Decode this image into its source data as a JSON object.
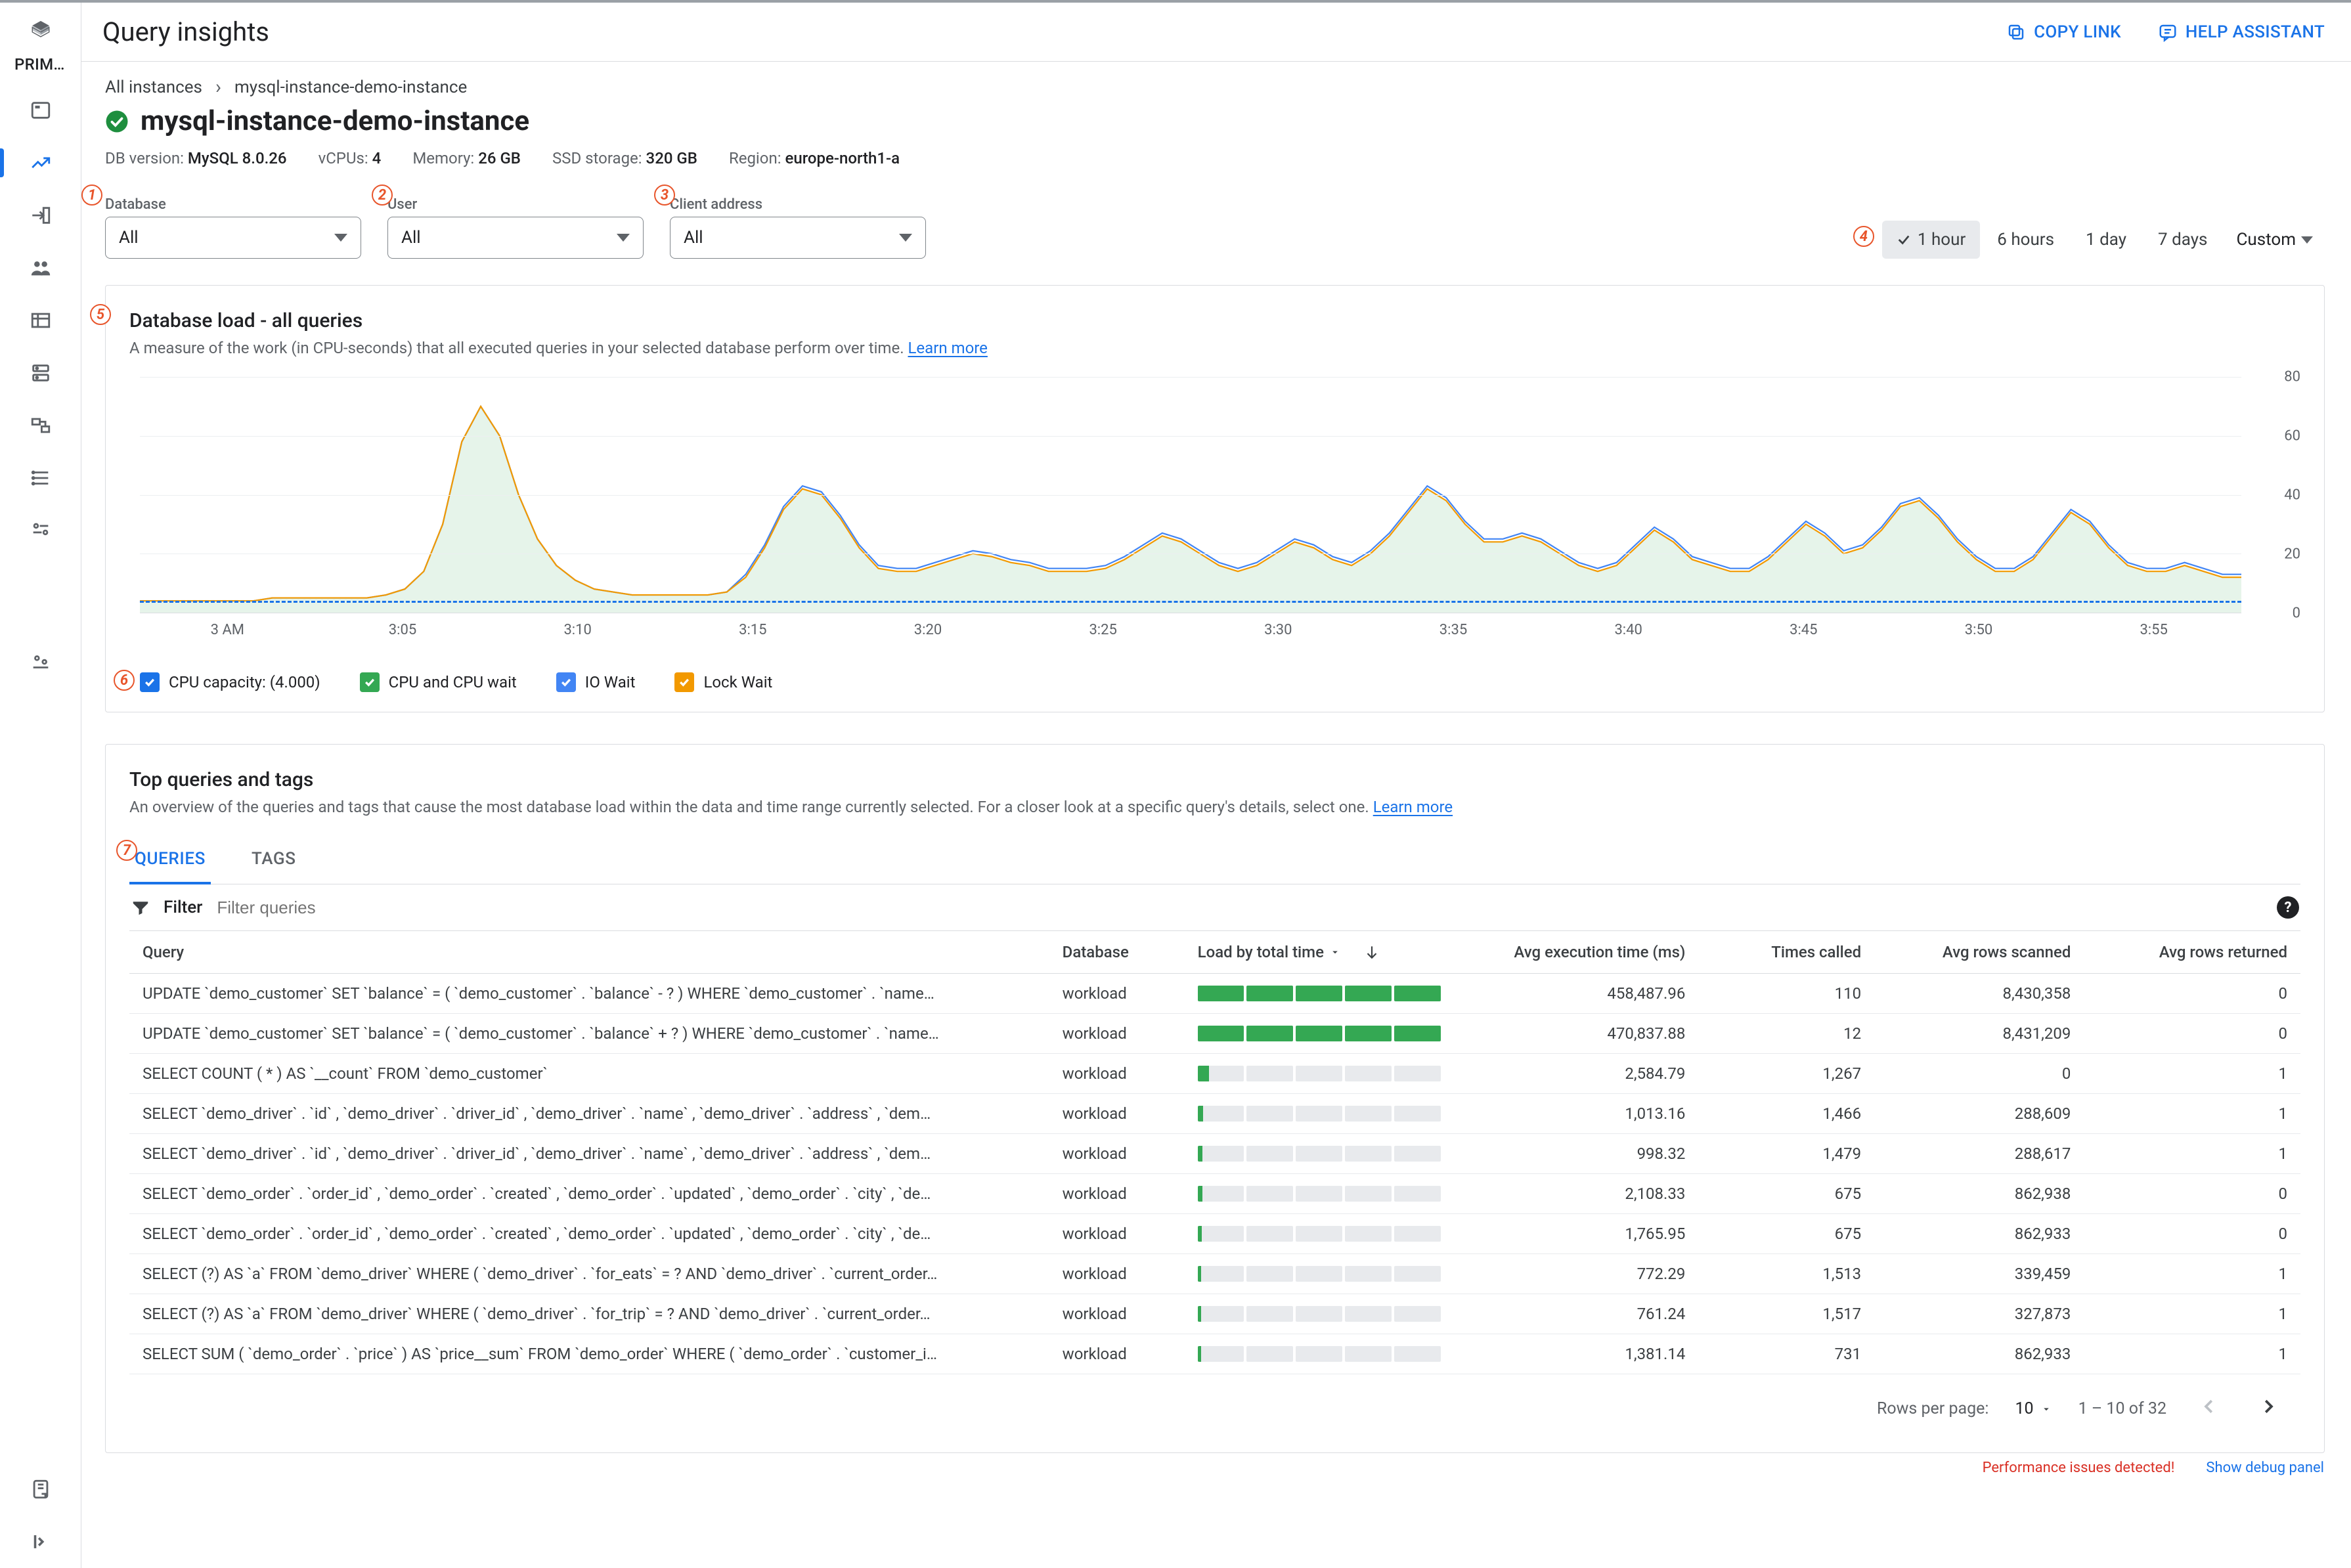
{
  "header": {
    "title": "Query insights",
    "copy_link": "COPY LINK",
    "help_assistant": "HELP ASSISTANT"
  },
  "sidebar": {
    "section_label": "PRIM…"
  },
  "breadcrumb": {
    "root": "All instances",
    "current": "mysql-instance-demo-instance"
  },
  "instance": {
    "title": "mysql-instance-demo-instance",
    "meta": {
      "db_version_label": "DB version:",
      "db_version": "MySQL 8.0.26",
      "vcpus_label": "vCPUs:",
      "vcpus": "4",
      "memory_label": "Memory:",
      "memory": "26 GB",
      "ssd_label": "SSD storage:",
      "ssd": "320 GB",
      "region_label": "Region:",
      "region": "europe-north1-a"
    }
  },
  "filters": {
    "database": {
      "label": "Database",
      "value": "All"
    },
    "user": {
      "label": "User",
      "value": "All"
    },
    "client_address": {
      "label": "Client address",
      "value": "All"
    },
    "badge1": "1",
    "badge2": "2",
    "badge3": "3"
  },
  "time_range": {
    "badge4": "4",
    "options": [
      "1 hour",
      "6 hours",
      "1 day",
      "7 days"
    ],
    "custom": "Custom",
    "active": "1 hour"
  },
  "chart_panel": {
    "badge5": "5",
    "badge6": "6",
    "title": "Database load - all queries",
    "subtitle": "A measure of the work (in CPU-seconds) that all executed queries in your selected database perform over time. ",
    "learn_more": "Learn more",
    "legend": {
      "cpu_capacity": "CPU capacity: (4.000)",
      "cpu_wait": "CPU and CPU wait",
      "io_wait": "IO Wait",
      "lock_wait": "Lock Wait"
    },
    "legend_colors": {
      "cpu_capacity": "#1a73e8",
      "cpu_wait": "#34a853",
      "io_wait": "#4285f4",
      "lock_wait": "#f29900"
    }
  },
  "chart_data": {
    "type": "area",
    "title": "Database load - all queries",
    "xlabel": "",
    "ylabel": "",
    "ylim": [
      0,
      80
    ],
    "x": [
      "3 AM",
      "3:05",
      "3:10",
      "3:15",
      "3:20",
      "3:25",
      "3:30",
      "3:35",
      "3:40",
      "3:45",
      "3:50",
      "3:55"
    ],
    "y_ticks": [
      0,
      20,
      40,
      60,
      80
    ],
    "cpu_capacity": 4.0,
    "series": [
      {
        "name": "Lock Wait",
        "color": "#f29900",
        "values_dense": [
          4,
          4,
          4,
          4,
          4,
          4,
          4,
          5,
          5,
          5,
          5,
          5,
          5,
          6,
          8,
          14,
          30,
          58,
          70,
          60,
          40,
          25,
          16,
          11,
          8,
          7,
          6,
          6,
          6,
          6,
          6,
          7,
          12,
          22,
          35,
          42,
          40,
          32,
          22,
          15,
          14,
          14,
          16,
          18,
          20,
          19,
          17,
          16,
          14,
          14,
          14,
          15,
          18,
          22,
          26,
          24,
          20,
          16,
          14,
          16,
          20,
          24,
          22,
          18,
          16,
          20,
          26,
          34,
          42,
          38,
          30,
          24,
          24,
          26,
          24,
          20,
          16,
          14,
          16,
          22,
          28,
          24,
          18,
          16,
          14,
          14,
          18,
          24,
          30,
          26,
          20,
          22,
          28,
          36,
          38,
          32,
          24,
          18,
          14,
          14,
          18,
          26,
          34,
          30,
          22,
          16,
          14,
          14,
          16,
          14,
          12,
          12
        ]
      },
      {
        "name": "IO Wait",
        "color": "#4285f4",
        "values_dense": [
          4,
          4,
          4,
          4,
          4,
          4,
          4,
          5,
          5,
          5,
          5,
          5,
          5,
          6,
          8,
          14,
          30,
          58,
          70,
          60,
          40,
          25,
          16,
          11,
          8,
          7,
          6,
          6,
          6,
          6,
          6,
          7,
          13,
          23,
          36,
          43,
          41,
          33,
          23,
          16,
          15,
          15,
          17,
          19,
          21,
          20,
          18,
          17,
          15,
          15,
          15,
          16,
          19,
          23,
          27,
          25,
          21,
          17,
          15,
          17,
          21,
          25,
          23,
          19,
          17,
          21,
          27,
          35,
          43,
          39,
          31,
          25,
          25,
          27,
          25,
          21,
          17,
          15,
          17,
          23,
          29,
          25,
          19,
          17,
          15,
          15,
          19,
          25,
          31,
          27,
          21,
          23,
          29,
          37,
          39,
          33,
          25,
          19,
          15,
          15,
          19,
          27,
          35,
          31,
          23,
          17,
          15,
          15,
          17,
          15,
          13,
          13
        ]
      },
      {
        "name": "CPU and CPU wait",
        "color": "#34a853",
        "values_dense": [
          4,
          4,
          4,
          4,
          4,
          4,
          4,
          5,
          5,
          5,
          5,
          5,
          5,
          6,
          8,
          14,
          30,
          58,
          70,
          60,
          40,
          25,
          16,
          11,
          8,
          7,
          6,
          6,
          6,
          6,
          6,
          7,
          12,
          22,
          35,
          42,
          40,
          32,
          22,
          15,
          14,
          14,
          16,
          18,
          20,
          19,
          17,
          16,
          14,
          14,
          14,
          15,
          18,
          22,
          26,
          24,
          20,
          16,
          14,
          16,
          20,
          24,
          22,
          18,
          16,
          20,
          26,
          34,
          42,
          38,
          30,
          24,
          24,
          26,
          24,
          20,
          16,
          14,
          16,
          22,
          28,
          24,
          18,
          16,
          14,
          14,
          18,
          24,
          30,
          26,
          20,
          22,
          28,
          36,
          38,
          32,
          24,
          18,
          14,
          14,
          18,
          26,
          34,
          30,
          22,
          16,
          14,
          14,
          16,
          14,
          12,
          12
        ]
      }
    ]
  },
  "top_queries": {
    "badge7": "7",
    "title": "Top queries and tags",
    "subtitle": "An overview of the queries and tags that cause the most database load within the data and time range currently selected. For a closer look at a specific query's details, select one. ",
    "learn_more": "Learn more",
    "tabs": {
      "queries": "QUERIES",
      "tags": "TAGS"
    },
    "filter_label": "Filter",
    "filter_placeholder": "Filter queries",
    "columns": {
      "query": "Query",
      "database": "Database",
      "load": "Load by total time",
      "avg_exec": "Avg execution time (ms)",
      "times_called": "Times called",
      "rows_scanned": "Avg rows scanned",
      "rows_returned": "Avg rows returned"
    },
    "rows": [
      {
        "query": "UPDATE `demo_customer` SET `balance` = ( `demo_customer` . `balance` - ? ) WHERE `demo_customer` . `name…",
        "database": "workload",
        "load": 5.0,
        "avg_exec": "458,487.96",
        "times_called": "110",
        "rows_scanned": "8,430,358",
        "rows_returned": "0"
      },
      {
        "query": "UPDATE `demo_customer` SET `balance` = ( `demo_customer` . `balance` + ? ) WHERE `demo_customer` . `name…",
        "database": "workload",
        "load": 5.0,
        "avg_exec": "470,837.88",
        "times_called": "12",
        "rows_scanned": "8,431,209",
        "rows_returned": "0"
      },
      {
        "query": "SELECT COUNT ( * ) AS `__count` FROM `demo_customer`",
        "database": "workload",
        "load": 0.25,
        "avg_exec": "2,584.79",
        "times_called": "1,267",
        "rows_scanned": "0",
        "rows_returned": "1"
      },
      {
        "query": "SELECT `demo_driver` . `id` , `demo_driver` . `driver_id` , `demo_driver` . `name` , `demo_driver` . `address` , `dem…",
        "database": "workload",
        "load": 0.12,
        "avg_exec": "1,013.16",
        "times_called": "1,466",
        "rows_scanned": "288,609",
        "rows_returned": "1"
      },
      {
        "query": "SELECT `demo_driver` . `id` , `demo_driver` . `driver_id` , `demo_driver` . `name` , `demo_driver` . `address` , `dem…",
        "database": "workload",
        "load": 0.1,
        "avg_exec": "998.32",
        "times_called": "1,479",
        "rows_scanned": "288,617",
        "rows_returned": "1"
      },
      {
        "query": "SELECT `demo_order` . `order_id` , `demo_order` . `created` , `demo_order` . `updated` , `demo_order` . `city` , `de…",
        "database": "workload",
        "load": 0.1,
        "avg_exec": "2,108.33",
        "times_called": "675",
        "rows_scanned": "862,938",
        "rows_returned": "0"
      },
      {
        "query": "SELECT `demo_order` . `order_id` , `demo_order` . `created` , `demo_order` . `updated` , `demo_order` . `city` , `de…",
        "database": "workload",
        "load": 0.09,
        "avg_exec": "1,765.95",
        "times_called": "675",
        "rows_scanned": "862,933",
        "rows_returned": "0"
      },
      {
        "query": "SELECT (?) AS `a` FROM `demo_driver` WHERE ( `demo_driver` . `for_eats` = ? AND `demo_driver` . `current_order…",
        "database": "workload",
        "load": 0.08,
        "avg_exec": "772.29",
        "times_called": "1,513",
        "rows_scanned": "339,459",
        "rows_returned": "1"
      },
      {
        "query": "SELECT (?) AS `a` FROM `demo_driver` WHERE ( `demo_driver` . `for_trip` = ? AND `demo_driver` . `current_order…",
        "database": "workload",
        "load": 0.08,
        "avg_exec": "761.24",
        "times_called": "1,517",
        "rows_scanned": "327,873",
        "rows_returned": "1"
      },
      {
        "query": "SELECT SUM ( `demo_order` . `price` ) AS `price__sum` FROM `demo_order` WHERE ( `demo_order` . `customer_i…",
        "database": "workload",
        "load": 0.07,
        "avg_exec": "1,381.14",
        "times_called": "731",
        "rows_scanned": "862,933",
        "rows_returned": "1"
      }
    ],
    "pagination": {
      "rows_per_page_label": "Rows per page:",
      "rows_per_page": "10",
      "range": "1 – 10 of 32"
    }
  },
  "footer": {
    "perf": "Performance issues detected!",
    "debug": "Show debug panel"
  }
}
